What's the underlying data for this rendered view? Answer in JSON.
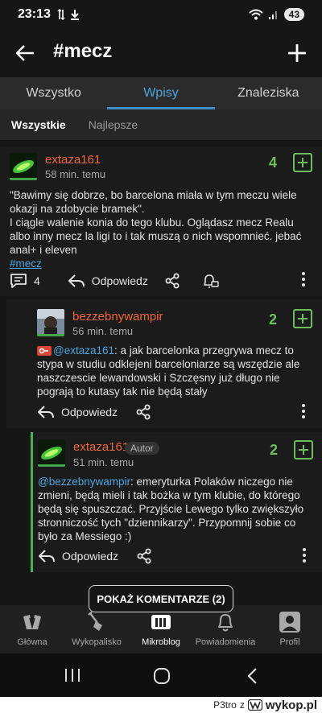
{
  "status_bar": {
    "time": "23:13",
    "battery": "43"
  },
  "app_bar": {
    "title": "#mecz"
  },
  "tabs": [
    {
      "label": "Wszystko",
      "active": false
    },
    {
      "label": "Wpisy",
      "active": true
    },
    {
      "label": "Znaleziska",
      "active": false
    }
  ],
  "sub_tabs": [
    {
      "label": "Wszystkie",
      "active": true
    },
    {
      "label": "Najlepsze",
      "active": false
    }
  ],
  "entry": {
    "username": "extaza161",
    "time_ago": "58 min. temu",
    "score": "4",
    "text_line1": "\"Bawimy się dobrze, bo barcelona miała w tym meczu wiele okazji na zdobycie bramek\".",
    "text_line2": "I ciągle walenie konia do tego klubu. Oglądasz mecz Realu albo inny mecz la ligi to i tak muszą o nich wspomnieć. jebać anal+ i eleven",
    "tag": "#mecz",
    "comment_count": "4",
    "reply_label": "Odpowiedz"
  },
  "reply1": {
    "username": "bezzebnywampir",
    "time_ago": "56 min. temu",
    "score": "2",
    "mention": "@extaza161",
    "text": ": a jak barcelonka przegrywa mecz to stypa w studiu odklejeni barceloniarze są wszędzie ale naszczescie lewandowski i Szczęsny już długo nie pograją to kutasy tak nie będą stały",
    "reply_label": "Odpowiedz"
  },
  "reply2": {
    "username": "extaza161",
    "badge": "Autor",
    "time_ago": "51 min. temu",
    "score": "2",
    "mention": "@bezzebnywampir",
    "text": ": emeryturka Polaków niczego nie zmieni, będą mieli i tak bożka w tym klubie, do którego będą się spuszczać. Przyjście Lewego tylko zwiększyło stronniczość tych \"dziennikarzy\". Przypomnij sobie co było za Messiego :)",
    "reply_label": "Odpowiedz"
  },
  "show_comments": "POKAŻ KOMENTARZE (2)",
  "bottom_nav": [
    {
      "label": "Główna",
      "icon": "home-w-icon",
      "active": false
    },
    {
      "label": "Wykopalisko",
      "icon": "shovel-icon",
      "active": false
    },
    {
      "label": "Mikroblog",
      "icon": "mikroblog-icon",
      "active": true
    },
    {
      "label": "Powiadomienia",
      "icon": "bell-icon",
      "active": false
    },
    {
      "label": "Profil",
      "icon": "profile-icon",
      "active": false
    }
  ],
  "footer": {
    "user": "P3tro",
    "separator": "z",
    "brand": "wykop.pl"
  },
  "colors": {
    "accent": "#4da6e0",
    "username": "#f0643a",
    "vote": "#6cbf5b",
    "background": "#161616"
  }
}
